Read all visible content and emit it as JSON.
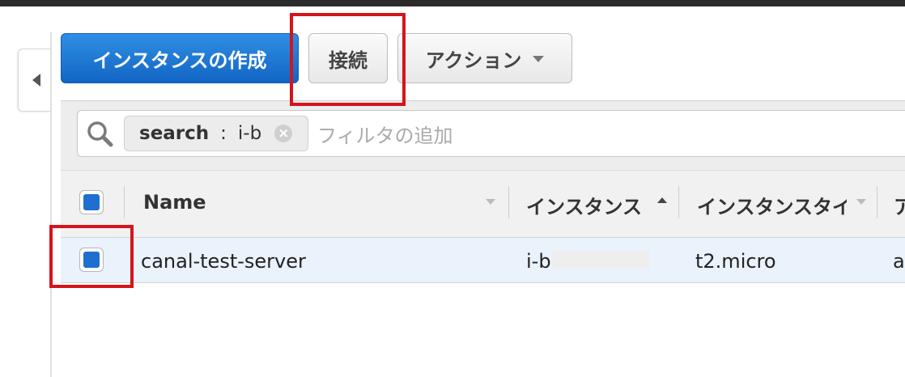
{
  "toolbar": {
    "create_instance_label": "インスタンスの作成",
    "connect_label": "接続",
    "actions_label": "アクション"
  },
  "filter": {
    "token_key": "search",
    "token_separator": ":",
    "token_value": "i-b",
    "placeholder": "フィルタの追加"
  },
  "table": {
    "columns": [
      {
        "label": "Name"
      },
      {
        "label": "インスタンス"
      },
      {
        "label": "インスタンスタイプ"
      },
      {
        "label": "ア"
      }
    ],
    "rows": [
      {
        "name": "canal-test-server",
        "instance_id": "i-b",
        "instance_type": "t2.micro",
        "az": "a"
      }
    ]
  },
  "colors": {
    "primary_button": "#1265c5",
    "highlight_box": "#d4151b",
    "checkbox_fill": "#1f6fd1",
    "selected_row": "#eaf2fc"
  },
  "icons": {
    "collapse": "triangle-left-icon",
    "search": "magnifier-icon",
    "clear": "circle-x-icon",
    "dropdown": "chevron-down-icon",
    "sort_asc": "caret-up-icon",
    "sort_desc": "caret-down-icon"
  }
}
